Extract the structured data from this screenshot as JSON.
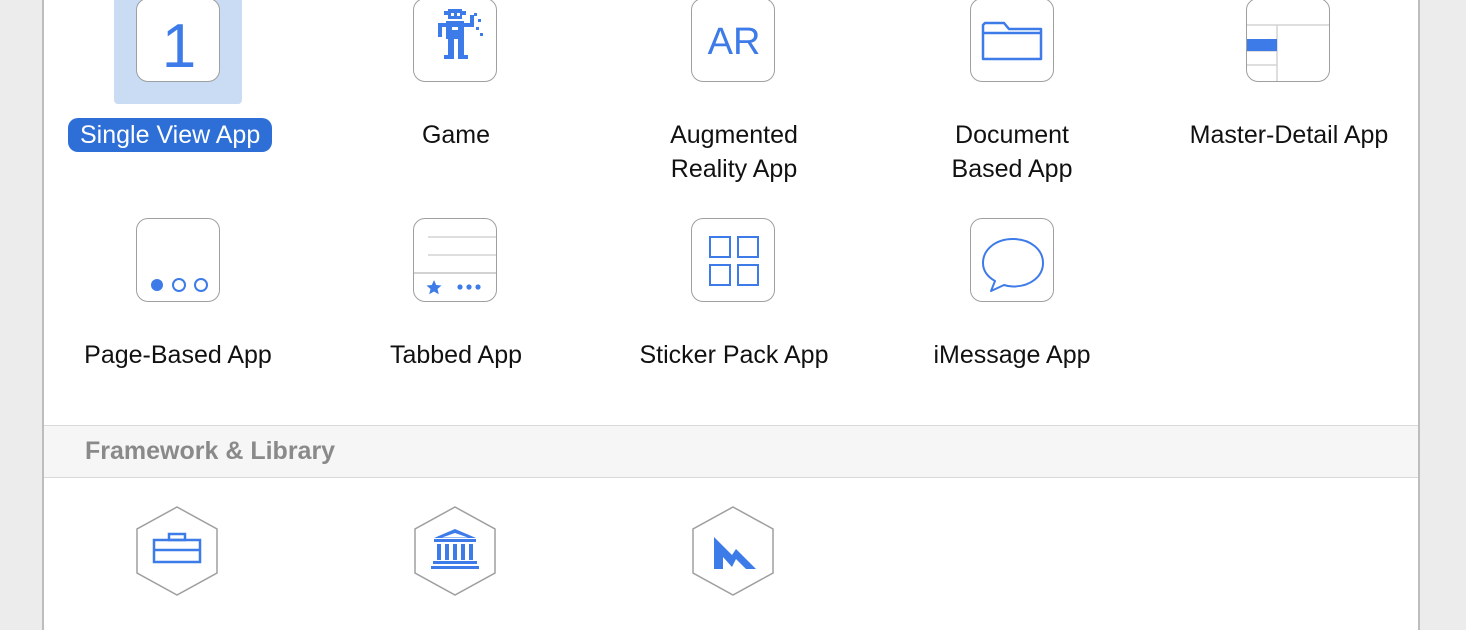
{
  "templates": [
    {
      "label": "Single View App",
      "icon": "number-one-icon",
      "selected": true
    },
    {
      "label": "Game",
      "icon": "game-character-icon"
    },
    {
      "label": "Augmented\nReality App",
      "icon": "ar-icon",
      "icon_text": "AR"
    },
    {
      "label": "Document\nBased App",
      "icon": "folder-icon"
    },
    {
      "label": "Master-Detail App",
      "icon": "master-detail-icon"
    },
    {
      "label": "Page-Based App",
      "icon": "page-dots-icon"
    },
    {
      "label": "Tabbed App",
      "icon": "tab-bar-icon"
    },
    {
      "label": "Sticker Pack App",
      "icon": "sticker-grid-icon"
    },
    {
      "label": "iMessage App",
      "icon": "speech-bubble-icon"
    }
  ],
  "single_view_icon_text": "1",
  "section": {
    "title": "Framework & Library"
  },
  "frameworks": [
    {
      "icon": "toolbox-icon"
    },
    {
      "icon": "library-building-icon"
    },
    {
      "icon": "metal-icon"
    }
  ],
  "colors": {
    "accent": "#2d6fd6",
    "icon_blue": "#3d7be8",
    "selection": "#c9dcf3"
  }
}
